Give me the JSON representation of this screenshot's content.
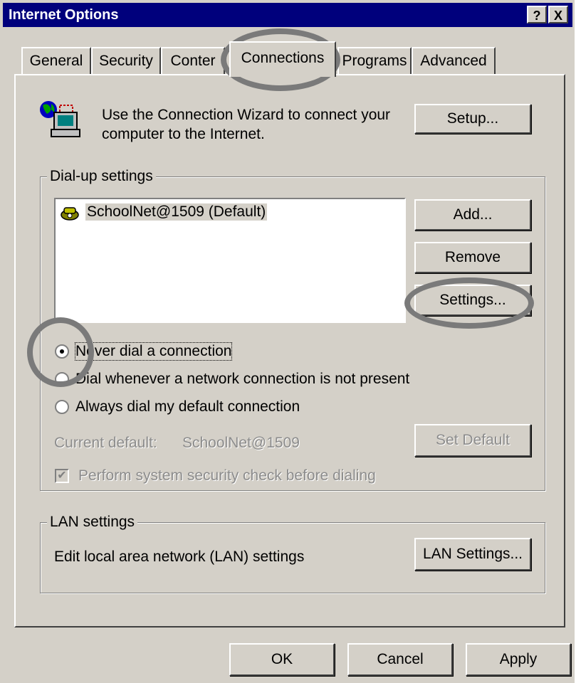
{
  "window": {
    "title": "Internet Options",
    "help_label": "?",
    "close_label": "X"
  },
  "tabs": [
    {
      "label": "General"
    },
    {
      "label": "Security"
    },
    {
      "label": "Conter"
    },
    {
      "label": "Connections"
    },
    {
      "label": "Programs"
    },
    {
      "label": "Advanced"
    }
  ],
  "wizard": {
    "line1": "Use the Connection Wizard to connect your",
    "line2": "computer to the Internet.",
    "setup_label": "Setup..."
  },
  "dialup": {
    "group_label": "Dial-up settings",
    "items": [
      {
        "label": "SchoolNet@1509 (Default)"
      }
    ],
    "add_label": "Add...",
    "remove_label": "Remove",
    "settings_label": "Settings...",
    "radio_never": "Never dial a connection",
    "radio_whenever": "Dial whenever a network connection is not present",
    "radio_always": "Always dial my default connection",
    "selected_option": "Never dial a connection",
    "current_default_label": "Current default:",
    "current_default_value": "SchoolNet@1509",
    "set_default_label": "Set Default",
    "security_check_label": "Perform system security check before dialing",
    "security_check_checked": true
  },
  "lan": {
    "group_label": "LAN settings",
    "description": "Edit local area network (LAN) settings",
    "button_label": "LAN Settings..."
  },
  "footer": {
    "ok_label": "OK",
    "cancel_label": "Cancel",
    "apply_label": "Apply"
  }
}
